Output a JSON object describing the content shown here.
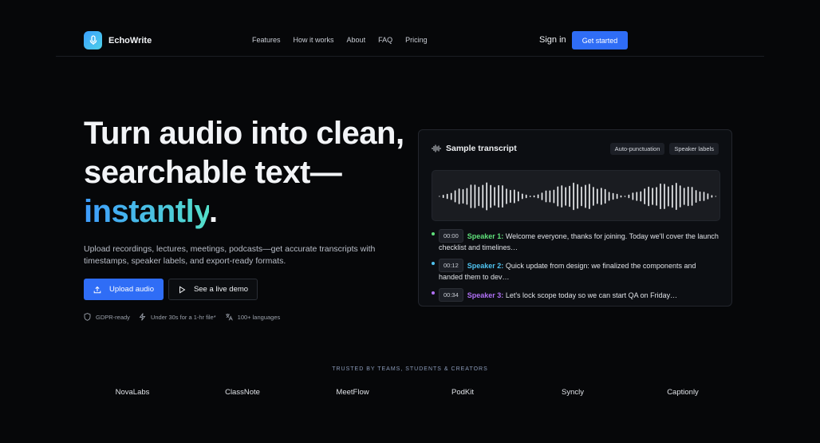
{
  "brand": {
    "name": "EchoWrite"
  },
  "nav": {
    "links": [
      "Features",
      "How it works",
      "About",
      "FAQ",
      "Pricing"
    ],
    "signin": "Sign in",
    "cta": "Get started"
  },
  "hero": {
    "title_line1": "Turn audio into clean,",
    "title_line2": "searchable text—",
    "title_accent": "instantly",
    "title_period": ".",
    "subtitle": "Upload recordings, lectures, meetings, podcasts—get accurate transcripts with timestamps, speaker labels, and export-ready formats.",
    "primary_button": "Upload audio",
    "secondary_button": "See a live demo",
    "features": [
      "GDPR-ready",
      "Under 30s for a 1-hr file*",
      "100+ languages"
    ]
  },
  "transcript_card": {
    "title": "Sample transcript",
    "chips": [
      "Auto-punctuation",
      "Speaker labels"
    ],
    "lines": [
      {
        "time": "00:00",
        "speaker": "Speaker 1:",
        "text": "Welcome everyone, thanks for joining. Today we'll cover the launch checklist and timelines…",
        "color": "#5fe07a"
      },
      {
        "time": "00:12",
        "speaker": "Speaker 2:",
        "text": "Quick update from design: we finalized the components and handed them to dev…",
        "color": "#4fc3f0"
      },
      {
        "time": "00:34",
        "speaker": "Speaker 3:",
        "text": "Let's lock scope today so we can start QA on Friday…",
        "color": "#b070f5"
      }
    ]
  },
  "trusted": {
    "label": "TRUSTED BY TEAMS, STUDENTS & CREATORS",
    "logos": [
      "NovaLabs",
      "ClassNote",
      "MeetFlow",
      "PodKit",
      "Syncly",
      "Captionly"
    ]
  },
  "colors": {
    "accent": "#2f6df6",
    "background": "#060709",
    "card": "#0c0e12"
  },
  "icons": {
    "logo": "microphone-icon",
    "upload": "upload-icon",
    "demo": "play-icon",
    "features": [
      "shield-icon",
      "lightning-icon",
      "translate-icon"
    ],
    "card": "waveform-icon"
  }
}
